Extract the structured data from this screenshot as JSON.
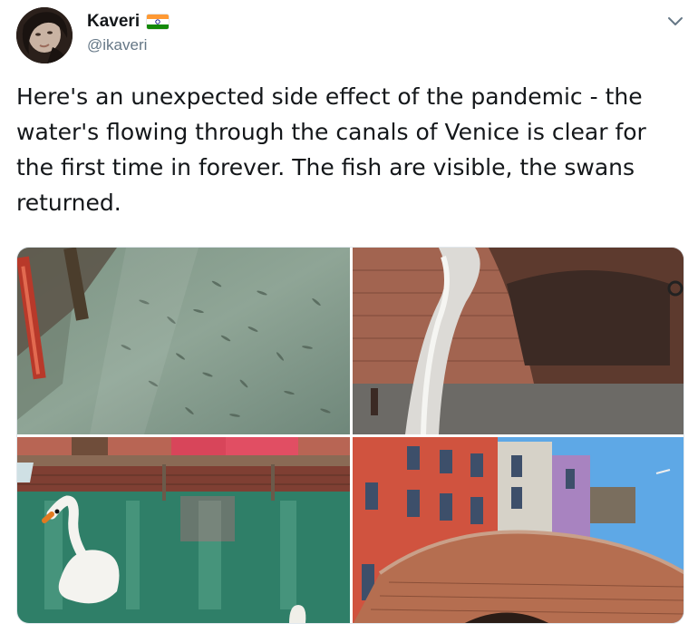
{
  "user": {
    "display_name": "Kaveri",
    "handle": "@ikaveri",
    "flag_icon": "india-flag-icon"
  },
  "tweet": {
    "text": "Here's an unexpected side effect of the pandemic - the water's flowing through the canals of Venice is clear for the first time in forever. The fish are visible, the swans returned."
  },
  "media": {
    "photos": [
      {
        "name": "clear-canal-fish-photo"
      },
      {
        "name": "stone-bridge-canal-photo"
      },
      {
        "name": "swan-canal-photo"
      },
      {
        "name": "colorful-houses-bridge-photo"
      }
    ]
  },
  "colors": {
    "text": "#14171a",
    "secondary_text": "#657786",
    "flag_saffron": "#ff9933",
    "flag_green": "#138808",
    "flag_chakra": "#000080"
  }
}
